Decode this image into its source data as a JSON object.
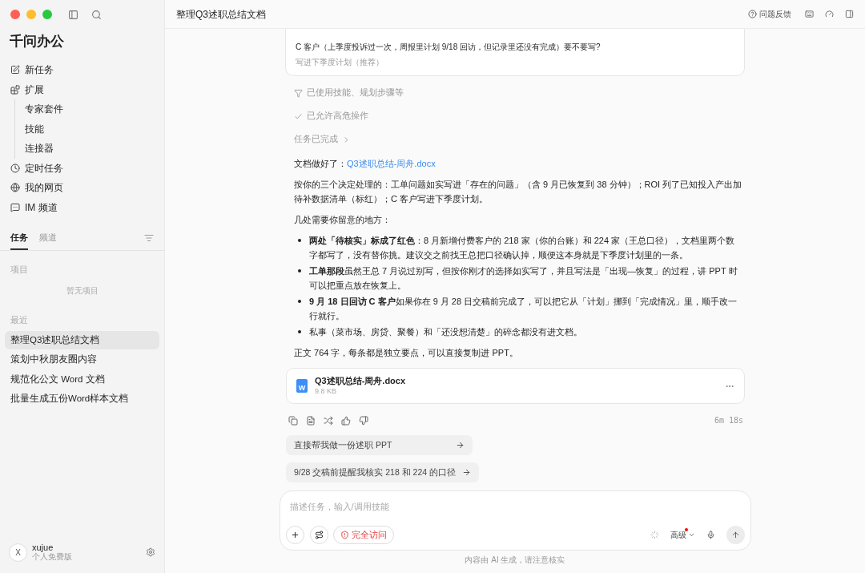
{
  "sidebar": {
    "app_title": "千问办公",
    "nav": [
      {
        "label": "新任务",
        "kind": "new"
      },
      {
        "label": "扩展",
        "kind": "ext",
        "children": [
          {
            "label": "专家套件"
          },
          {
            "label": "技能"
          },
          {
            "label": "连接器"
          }
        ]
      },
      {
        "label": "定时任务",
        "kind": "clock"
      },
      {
        "label": "我的网页",
        "kind": "globe"
      },
      {
        "label": "IM 频道",
        "kind": "chat"
      }
    ],
    "tabs": [
      {
        "label": "任务",
        "selected": true
      },
      {
        "label": "频道",
        "selected": false
      }
    ],
    "projects_heading": "项目",
    "projects_empty": "暂无项目",
    "recent_heading": "最近",
    "recent": [
      {
        "label": "整理Q3述职总结文档",
        "selected": true
      },
      {
        "label": "策划中秋朋友圈内容",
        "selected": false
      },
      {
        "label": "规范化公文 Word 文档",
        "selected": false
      },
      {
        "label": "批量生成五份Word样本文档",
        "selected": false
      }
    ],
    "user": {
      "avatar": "X",
      "name": "xujue",
      "plan": "个人免费版"
    }
  },
  "header": {
    "title": "整理Q3述职总结文档",
    "feedback": "问题反馈"
  },
  "question_card": {
    "question": "C 客户（上季度投诉过一次，周报里计划 9/18 回访，但记录里还没有完成）要不要写?",
    "answer": "写进下季度计划（推荐）"
  },
  "steps": [
    {
      "kind": "skills",
      "label": "已使用技能、规划步骤等"
    },
    {
      "kind": "check",
      "label": "已允许高危操作"
    },
    {
      "kind": "done",
      "label": "任务已完成"
    }
  ],
  "message": {
    "intro": "文档做好了：",
    "link": "Q3述职总结-周舟.docx",
    "paragraph": "按你的三个决定处理的：工单问题如实写进「存在的问题」（含 9 月已恢复到 38 分钟）；ROI 列了已知投入产出加待补数据清单（标红）；C 客户写进下季度计划。",
    "notes_heading": "几处需要你留意的地方：",
    "bullets": [
      "**两处「待核实」标成了红色**：8 月新增付费客户的 218 家（你的台账）和 224 家（王总口径），文档里两个数字都写了，没有替你挑。建议交之前找王总把口径确认掉，顺便这本身就是下季度计划里的一条。",
      "**工单那段**虽然王总 7 月说过别写，但按你刚才的选择如实写了，并且写法是「出现—恢复」的过程，讲 PPT 时可以把重点放在恢复上。",
      "**9 月 18 日回访 C 客户**如果你在 9 月 28 日交稿前完成了，可以把它从「计划」挪到「完成情况」里，顺手改一行就行。",
      "私事（菜市场、房贷、聚餐）和「还没想清楚」的碎念都没有进文档。"
    ],
    "summary": "正文 764 字，每条都是独立要点，可以直接复制进 PPT。"
  },
  "file": {
    "name": "Q3述职总结-周舟.docx",
    "size": "9.8 KB",
    "icon_letter": "W"
  },
  "elapsed": "6m 18s",
  "suggestions": [
    "直接帮我做一份述职 PPT",
    "9/28 交稿前提醒我核实 218 和 224 的口径"
  ],
  "composer": {
    "placeholder": "描述任务，输入/调用技能",
    "access": "完全访问",
    "mode": "高级",
    "mode_dot": true
  },
  "footer": "内容由 AI 生成，请注意核实"
}
